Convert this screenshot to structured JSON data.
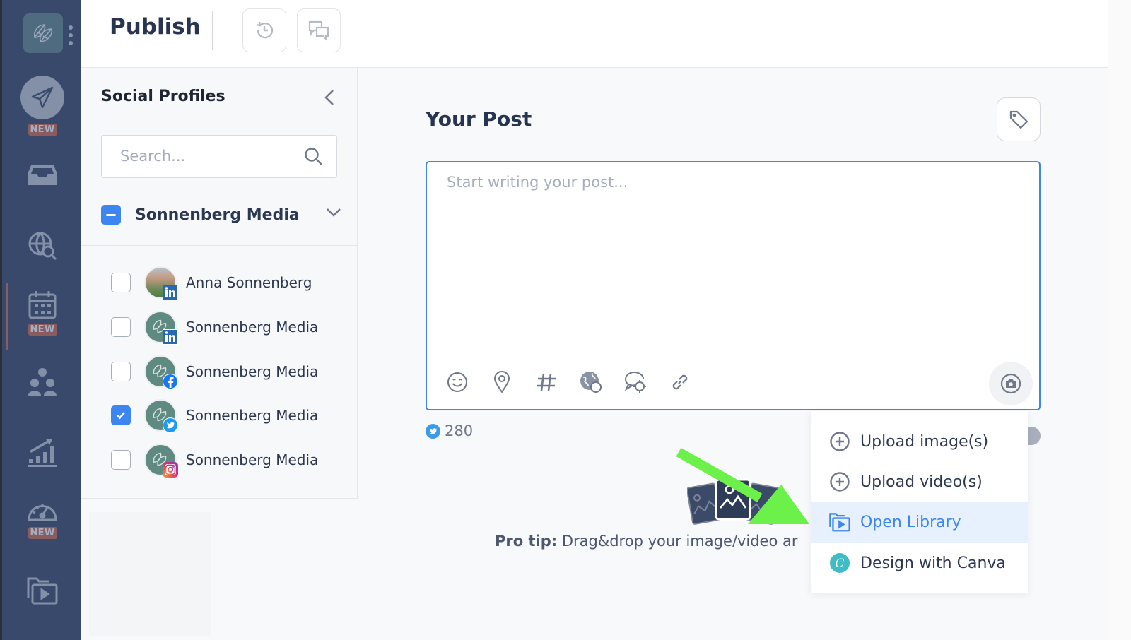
{
  "rail": {
    "logo_icon": "leaf-globe-logo-icon",
    "items": [
      {
        "name": "publish",
        "icon": "paper-plane-icon",
        "badge": "NEW",
        "active": true
      },
      {
        "name": "inbox",
        "icon": "inbox-tray-icon"
      },
      {
        "name": "listening",
        "icon": "globe-search-icon"
      },
      {
        "name": "calendar",
        "icon": "calendar-icon",
        "badge": "NEW"
      },
      {
        "name": "community",
        "icon": "users-group-icon"
      },
      {
        "name": "analytics",
        "icon": "growth-chart-icon"
      },
      {
        "name": "dashboard",
        "icon": "speedometer-icon",
        "badge": "NEW"
      },
      {
        "name": "media-library",
        "icon": "media-folder-icon"
      }
    ]
  },
  "header": {
    "title": "Publish",
    "history_icon": "history-icon",
    "comments_icon": "chat-bubbles-icon"
  },
  "profiles": {
    "title": "Social Profiles",
    "search_placeholder": "Search...",
    "search_value": "",
    "group": {
      "name": "Sonnenberg Media",
      "state": "indeterminate"
    },
    "items": [
      {
        "name": "Anna Sonnenberg",
        "network": "linkedin",
        "checked": false
      },
      {
        "name": "Sonnenberg Media",
        "network": "linkedin",
        "checked": false
      },
      {
        "name": "Sonnenberg Media",
        "network": "facebook",
        "checked": false
      },
      {
        "name": "Sonnenberg Media",
        "network": "twitter",
        "checked": true
      },
      {
        "name": "Sonnenberg Media",
        "network": "instagram",
        "checked": false
      }
    ]
  },
  "post": {
    "title": "Your Post",
    "placeholder": "Start writing your post...",
    "value": "",
    "toolbar": [
      "emoji-icon",
      "location-pin-icon",
      "hashtag-icon",
      "globe-settings-icon",
      "chat-settings-icon",
      "link-icon"
    ],
    "char_count": "280",
    "char_count_network": "twitter"
  },
  "pro_tip": {
    "label": "Pro tip:",
    "text": "Drag&drop your image/video ar"
  },
  "media_menu": {
    "items": [
      {
        "label": "Upload image(s)",
        "icon": "plus-circle-icon"
      },
      {
        "label": "Upload video(s)",
        "icon": "plus-circle-icon"
      },
      {
        "label": "Open Library",
        "icon": "media-folder-icon",
        "highlighted": true
      },
      {
        "label": "Design with Canva",
        "icon": "canva-icon"
      }
    ]
  },
  "colors": {
    "accent": "#3d86f0",
    "rail_bg": "#38496b",
    "badge": "#8c5b5e",
    "annotation_arrow": "#6cf04a",
    "avatar_teal": "#5f8a82"
  }
}
